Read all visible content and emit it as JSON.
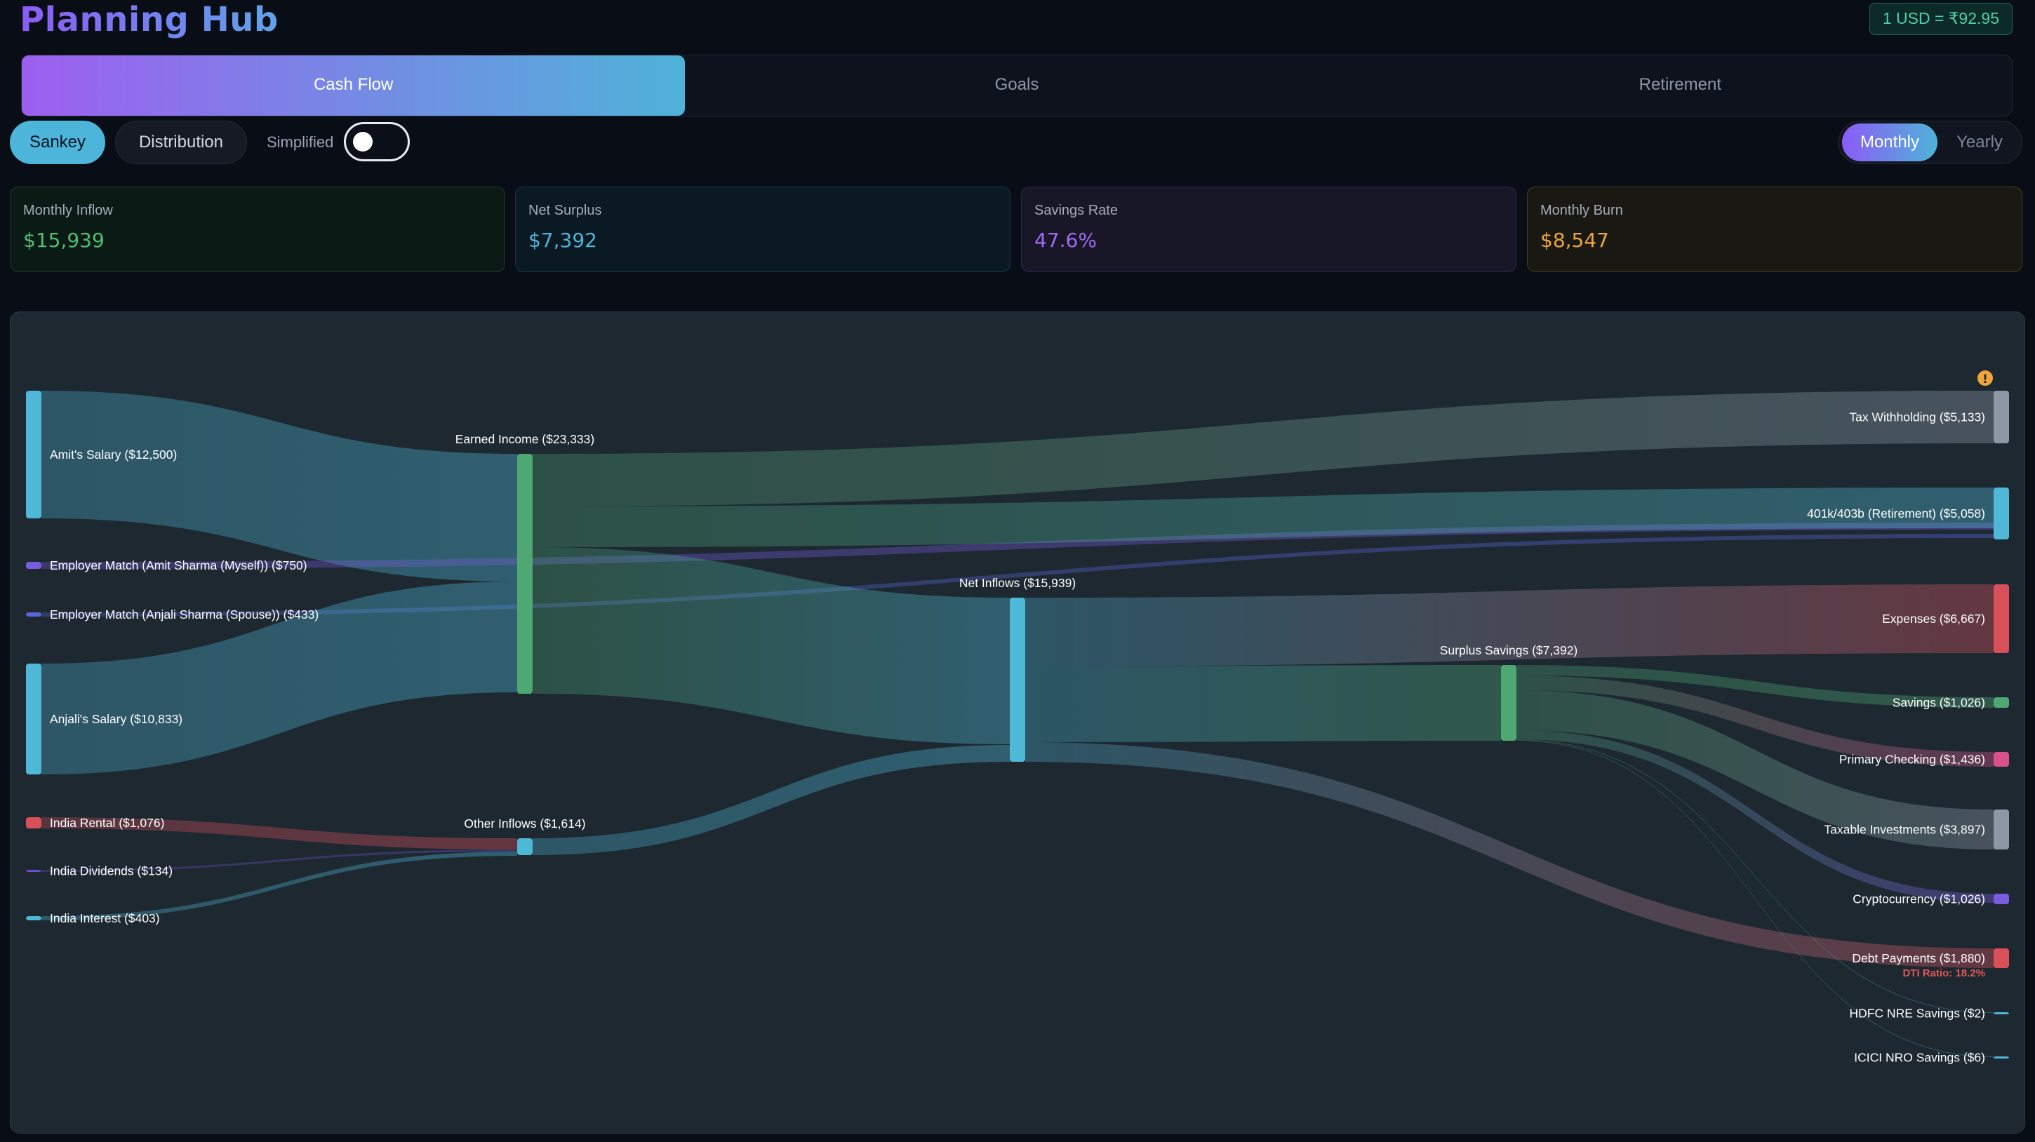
{
  "app": {
    "title": "Planning Hub",
    "fx_rate": "1 USD = ₹92.95"
  },
  "tabs": [
    {
      "label": "Cash Flow"
    },
    {
      "label": "Goals"
    },
    {
      "label": "Retirement"
    }
  ],
  "view_toggle": {
    "sankey": "Sankey",
    "distribution": "Distribution",
    "simplified_label": "Simplified",
    "simplified_on": false
  },
  "period": {
    "monthly": "Monthly",
    "yearly": "Yearly",
    "selected": "Monthly"
  },
  "summary": [
    {
      "label": "Monthly Inflow",
      "value": "$15,939"
    },
    {
      "label": "Net Surplus",
      "value": "$7,392"
    },
    {
      "label": "Savings Rate",
      "value": "47.6%"
    },
    {
      "label": "Monthly Burn",
      "value": "$8,547"
    }
  ],
  "sankey": {
    "nodes": [
      {
        "id": "amit",
        "label": "Amit's Salary ($12,500)",
        "value": 12500,
        "color": "#4fb8d6"
      },
      {
        "id": "match_amit",
        "label": "Employer Match (Amit Sharma (Myself)) ($750)",
        "value": 750,
        "color": "#7a5ce0"
      },
      {
        "id": "match_anjali",
        "label": "Employer Match (Anjali Sharma (Spouse)) ($433)",
        "value": 433,
        "color": "#5a66d8"
      },
      {
        "id": "anjali",
        "label": "Anjali's Salary ($10,833)",
        "value": 10833,
        "color": "#4fb8d6"
      },
      {
        "id": "rental",
        "label": "India Rental ($1,076)",
        "value": 1076,
        "color": "#d9505a"
      },
      {
        "id": "dividends",
        "label": "India Dividends ($134)",
        "value": 134,
        "color": "#6b4fc8"
      },
      {
        "id": "interest",
        "label": "India Interest ($403)",
        "value": 403,
        "color": "#4fb8d6"
      },
      {
        "id": "earned",
        "label": "Earned Income ($23,333)",
        "value": 23333,
        "color": "#4fa874"
      },
      {
        "id": "other",
        "label": "Other Inflows ($1,614)",
        "value": 1614,
        "color": "#4fb8d6"
      },
      {
        "id": "net",
        "label": "Net Inflows ($15,939)",
        "value": 15939,
        "color": "#4fb8d6"
      },
      {
        "id": "surplus",
        "label": "Surplus Savings ($7,392)",
        "value": 7392,
        "color": "#4fa874"
      },
      {
        "id": "tax",
        "label": "Tax Withholding ($5,133)",
        "value": 5133,
        "color": "#8e97a6"
      },
      {
        "id": "k401",
        "label": "401k/403b (Retirement) ($5,058)",
        "value": 5058,
        "color": "#4fb8d6"
      },
      {
        "id": "expenses",
        "label": "Expenses ($6,667)",
        "value": 6667,
        "color": "#d9505a"
      },
      {
        "id": "savings",
        "label": "Savings ($1,026)",
        "value": 1026,
        "color": "#4fa874"
      },
      {
        "id": "checking",
        "label": "Primary Checking ($1,436)",
        "value": 1436,
        "color": "#d9508a"
      },
      {
        "id": "taxable",
        "label": "Taxable Investments ($3,897)",
        "value": 3897,
        "color": "#8e97a6"
      },
      {
        "id": "crypto",
        "label": "Cryptocurrency ($1,026)",
        "value": 1026,
        "color": "#7a5ce0"
      },
      {
        "id": "debt",
        "label": "Debt Payments ($1,880)",
        "value": 1880,
        "color": "#d9505a"
      },
      {
        "id": "hdfc",
        "label": "HDFC NRE Savings ($2)",
        "value": 2,
        "color": "#4fb8d6"
      },
      {
        "id": "icici",
        "label": "ICICI NRO Savings ($6)",
        "value": 6,
        "color": "#4fb8d6"
      }
    ],
    "dti_note": "DTI Ratio: 18.2%",
    "warning_icon": "warning-icon"
  }
}
